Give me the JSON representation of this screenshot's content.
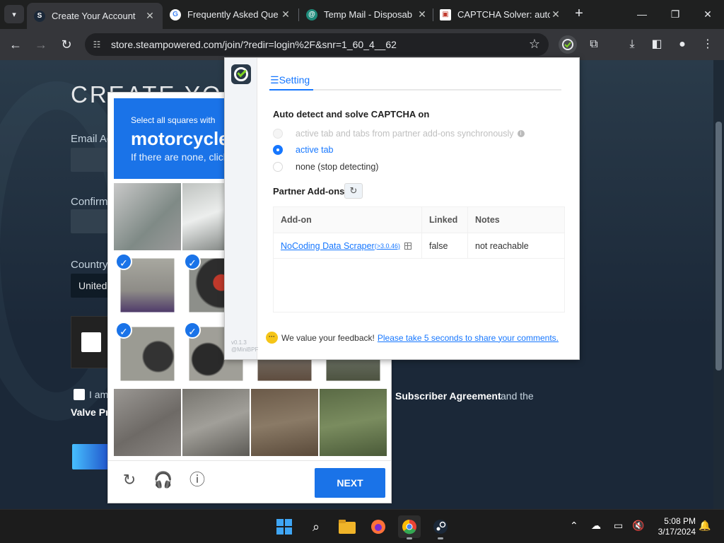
{
  "browser": {
    "tabs": [
      {
        "title": "Create Your Account",
        "active": true
      },
      {
        "title": "Frequently Asked Que",
        "active": false
      },
      {
        "title": "Temp Mail - Disposab",
        "active": false
      },
      {
        "title": "CAPTCHA Solver: auto",
        "active": false
      }
    ],
    "url": "store.steampowered.com/join/?redir=login%2F&snr=1_60_4__62"
  },
  "steam_page": {
    "heading": "CREATE YOU",
    "email_label": "Email Ac",
    "confirm_label": "Confirm",
    "country_label": "Country",
    "country_value": "United",
    "agree_prefix": "I am",
    "subscriber_agreement": "Subscriber Agreement",
    "and_the": "and the",
    "valve_privacy": "Valve Pr"
  },
  "recaptcha": {
    "instruction": "Select all squares with",
    "object": "motorcycles",
    "hint": "If there are none, click skip",
    "next_label": "NEXT",
    "selected_tiles": [
      4,
      5,
      8,
      9
    ]
  },
  "extension_popup": {
    "tab_label": "Setting",
    "auto_detect_heading": "Auto detect and solve CAPTCHA on",
    "options": [
      {
        "label": "active tab and tabs from partner add-ons synchronously",
        "state": "disabled"
      },
      {
        "label": "active tab",
        "state": "checked"
      },
      {
        "label": "none (stop detecting)",
        "state": "normal"
      }
    ],
    "partner_heading": "Partner Add-ons",
    "table": {
      "headers": [
        "Add-on",
        "Linked",
        "Notes"
      ],
      "rows": [
        {
          "addon": "NoCoding Data Scraper",
          "version": "(>3.0.46)",
          "linked": "false",
          "notes": "not reachable"
        }
      ]
    },
    "feedback_text": "We value your feedback!",
    "feedback_link": "Please take 5 seconds to share your comments.",
    "version": "v0.1.3",
    "brand": "@MiniBPF"
  },
  "taskbar": {
    "time": "5:08 PM",
    "date": "3/17/2024"
  },
  "colors": {
    "accent_blue": "#1a73e8",
    "link_blue": "#1677ff",
    "steam_bg": "#1b2838"
  }
}
